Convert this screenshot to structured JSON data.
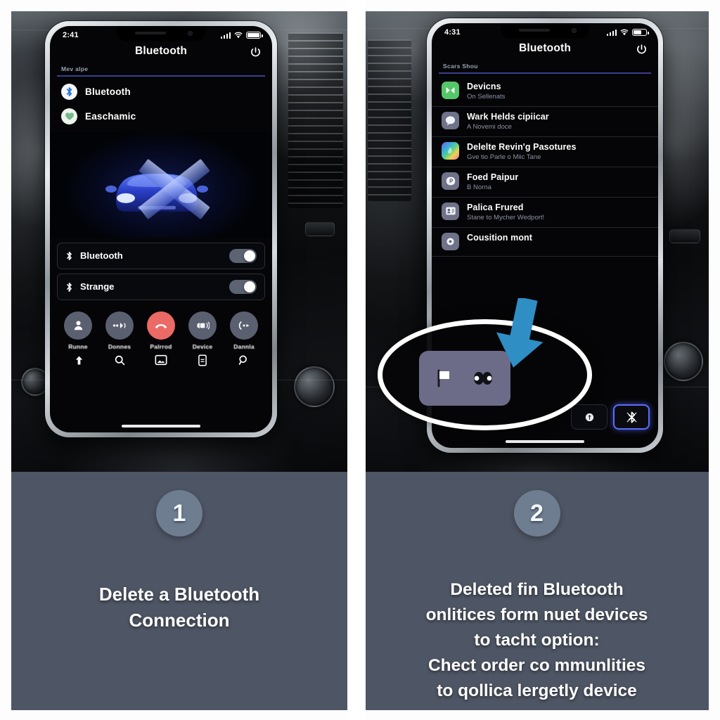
{
  "panels": [
    {
      "id": "left",
      "phone": {
        "status": {
          "time": "2:41",
          "signal_icon": "cellular-bars-icon",
          "wifi_icon": "wifi-icon",
          "battery_icon": "battery-icon"
        },
        "nav": {
          "title": "Bluetooth",
          "power_icon": "power-icon"
        },
        "section_header": "Mev alpe",
        "app_rows": [
          {
            "label": "Bluetooth",
            "icon": "bluetooth-icon",
            "icon_color": "#1f6fe0"
          },
          {
            "label": "Easchamic",
            "icon": "heart-icon",
            "icon_color": "#5fae77"
          }
        ],
        "artwork": {
          "name": "blue-car-graphic",
          "overlay": "x-mark"
        },
        "toggles": [
          {
            "label": "Bluetooth",
            "icon": "bluetooth-icon",
            "state": "on"
          },
          {
            "label": "Strange",
            "icon": "bluetooth-mic-icon",
            "state": "on"
          }
        ],
        "call_actions": [
          {
            "label": "Runne",
            "icon": "contact-icon",
            "color": "#5b6070"
          },
          {
            "label": "Donnes",
            "icon": "volume-low-icon",
            "color": "#5b6070"
          },
          {
            "label": "Palrrod",
            "icon": "end-call-icon",
            "color": "#ec6a66"
          },
          {
            "label": "Device",
            "icon": "speaker-icon",
            "color": "#5b6070"
          },
          {
            "label": "Dannla",
            "icon": "call-forward-icon",
            "color": "#5b6070"
          }
        ],
        "tab_icons": [
          "upload-icon",
          "search-icon",
          "image-icon",
          "phone-book-icon",
          "search-alt-icon"
        ]
      },
      "caption": {
        "number": "1",
        "lines": [
          "Delete a Bluetooth",
          "Connection"
        ]
      }
    },
    {
      "id": "right",
      "phone": {
        "status": {
          "time": "4:31",
          "signal_icon": "cellular-bars-icon",
          "wifi_icon": "wifi-icon",
          "battery_icon": "battery-icon"
        },
        "nav": {
          "title": "Bluetooth",
          "power_icon": "power-icon"
        },
        "section_header": "Scars Shou",
        "settings_rows": [
          {
            "title": "Devicns",
            "sub": "On Sellenats",
            "icon": "media-icon",
            "icon_color": "#55c66a"
          },
          {
            "title": "Wark Helds cipiicar",
            "sub": "A Novemi doce",
            "icon": "message-icon",
            "icon_color": "#6f7288"
          },
          {
            "title": "Delelte Revin'g Pasotures",
            "sub": "Gve tio Parle o Miic Tane",
            "icon": "photos-icon",
            "icon_color": "#b57fe0"
          },
          {
            "title": "Foed Paipur",
            "sub": "B Norna",
            "icon": "passbook-icon",
            "icon_color": "#6f7288"
          },
          {
            "title": "Palica Frured",
            "sub": "Stane to Mycher Wedport!",
            "icon": "contact-card-icon",
            "icon_color": "#6f7288"
          },
          {
            "title": "Cousition mont",
            "sub": "",
            "icon": "settings-icon",
            "icon_color": "#6f7288"
          }
        ],
        "bottom_tools": [
          {
            "icon": "badge-icon",
            "highlighted": false
          },
          {
            "icon": "bluetooth-x-icon",
            "highlighted": true
          }
        ],
        "callout": {
          "name": "zoom-callout-ellipse",
          "arrow": "pointer-arrow-icon",
          "arrow_color": "#2f8ec4",
          "chip": {
            "icons": [
              "flag-icon",
              "earbuds-icon"
            ],
            "color": "#6c6c88"
          }
        }
      },
      "caption": {
        "number": "2",
        "lines": [
          "Deleted fin Bluetooth",
          "onlitices form nuet devices",
          "to tacht option:",
          "Chect order co mmunlities",
          "to qollica lergetly device"
        ]
      }
    }
  ],
  "colors": {
    "caption_bg": "#4e5564",
    "badge_bg": "#6e7d90",
    "accent_blue": "#5b6cff",
    "arrow_blue": "#2f8ec4",
    "end_call_red": "#ec6a66",
    "rule_blue": "#3a3f8f"
  }
}
